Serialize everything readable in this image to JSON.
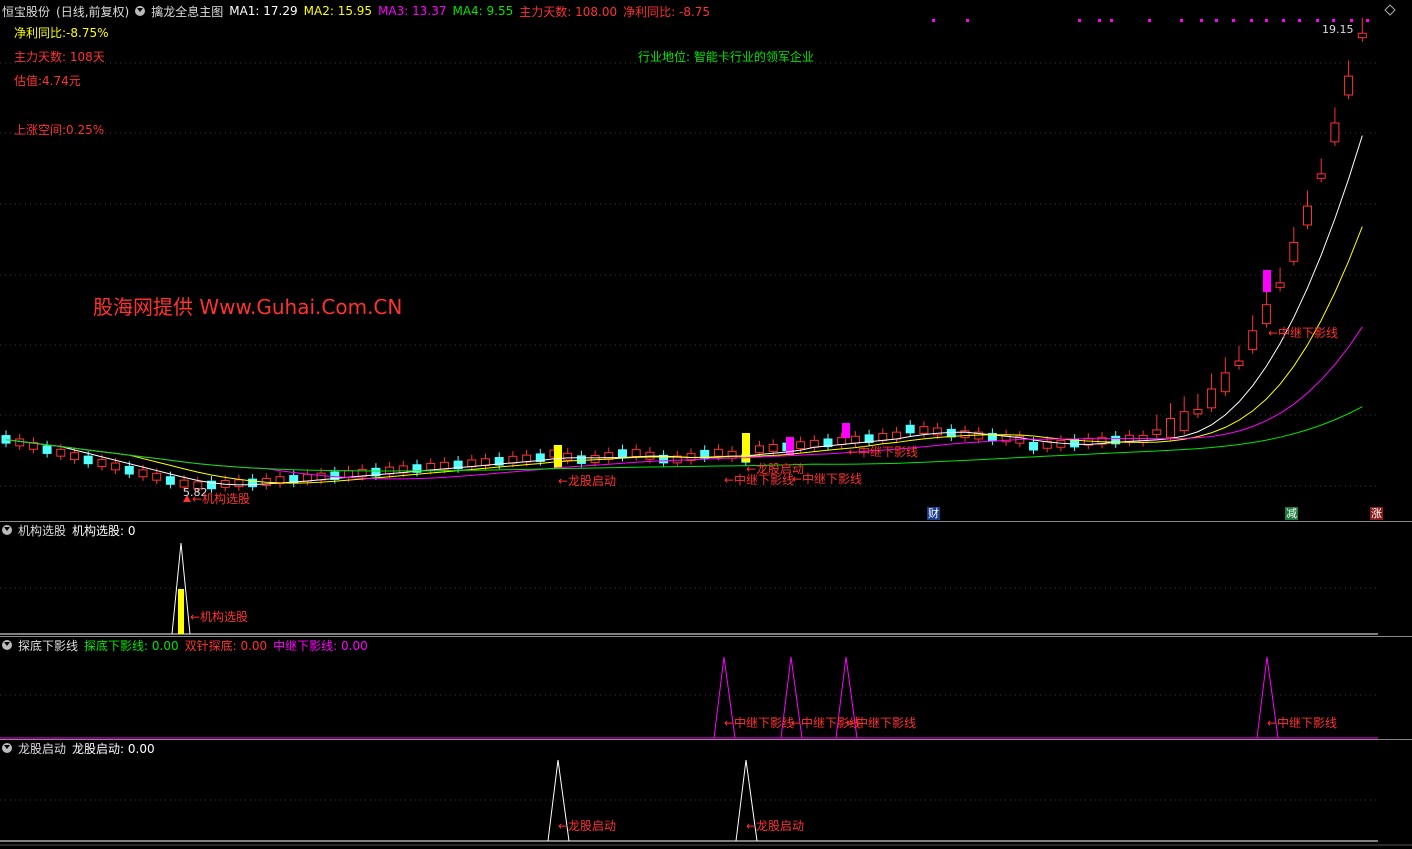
{
  "main_header": {
    "stock_name": "恒宝股份",
    "period_label": "(日线,前复权)",
    "indicator_name": "擒龙全息主图",
    "ma1": "MA1: 17.29",
    "ma2": "MA2: 15.95",
    "ma3": "MA3: 13.37",
    "ma4": "MA4: 9.55",
    "main_days": "主力天数: 108.00",
    "net_profit_yoy": "净利同比: -8.75"
  },
  "info_panel": {
    "net_profit_yoy": "净利同比:-8.75%",
    "main_days": "主力天数: 108天",
    "valuation": "估值:4.74元",
    "upside": "上涨空间:0.25%"
  },
  "industry_note": "行业地位: 智能卡行业的领军企业",
  "watermark": "股海网提供 Www.Guhai.Com.CN",
  "price_labels": {
    "high": "19.15",
    "low": "5.82"
  },
  "chart_annotations": {
    "inst_pick": "←机构选股",
    "dragon_start_1": "←龙股启动",
    "dragon_start_2": "←龙股启动",
    "relay_1": "←中继下影线",
    "relay_2": "←中继下影线",
    "relay_3": "←中继下影线",
    "relay_4": "←中继下影线"
  },
  "event_badges": {
    "finance": "财",
    "reduce": "减",
    "rise": "涨"
  },
  "panel_inst": {
    "name": "机构选股",
    "value_text": "机构选股: 0",
    "annotation": "←机构选股"
  },
  "panel_probe": {
    "name": "探底下影线",
    "v1": "探底下影线: 0.00",
    "v2": "双针探底: 0.00",
    "v3": "中继下影线: 0.00",
    "annotations": [
      "←中继下影线",
      "←中继下影线",
      "←中继下影线",
      "←中继下影线"
    ]
  },
  "panel_dragon": {
    "name": "龙股启动",
    "value_text": "龙股启动: 0.00",
    "annotations": [
      "←龙股启动",
      "←龙股启动"
    ]
  },
  "colors": {
    "up": "#ff3232",
    "down": "#54ffff",
    "ma1": "#ffffff",
    "ma2": "#ffff00",
    "ma3": "#ff00ff",
    "ma4": "#00e600",
    "signal_yellow": "#ffff00",
    "signal_magenta": "#ff00ff"
  }
}
